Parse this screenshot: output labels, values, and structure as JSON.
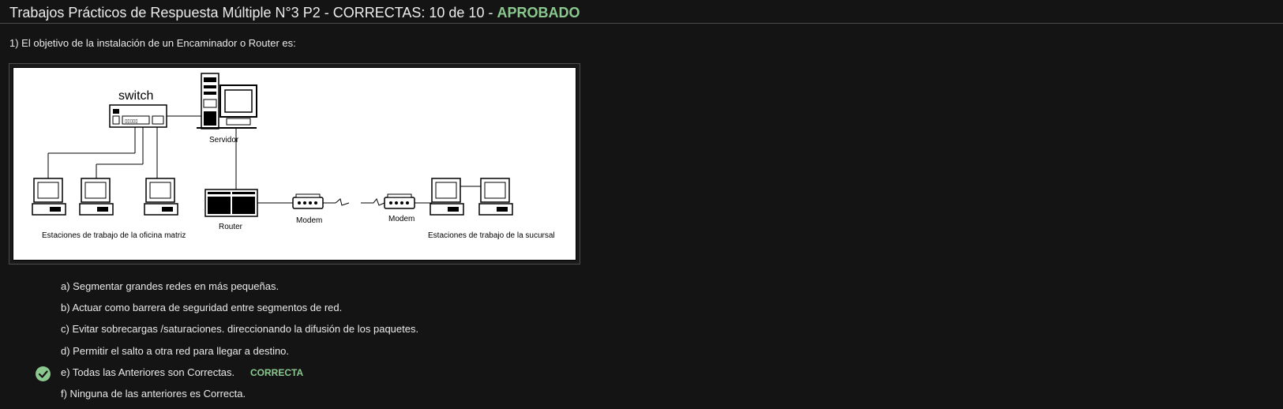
{
  "header": {
    "title": "Trabajos Prácticos de Respuesta Múltiple N°3 P2 - CORRECTAS: 10 de 10 - ",
    "status": "APROBADO"
  },
  "question": {
    "text": "1) El objetivo de la instalación de un Encaminador o Router es:"
  },
  "diagram": {
    "switch": "switch",
    "servidor": "Servidor",
    "router": "Router",
    "modem_left": "Modem",
    "modem_right": "Modem",
    "estaciones_matriz": "Estaciones de trabajo de la oficina matriz",
    "estaciones_sucursal": "Estaciones de trabajo de la sucursal"
  },
  "options": [
    {
      "label": "a) Segmentar grandes redes en más pequeñas."
    },
    {
      "label": "b) Actuar como barrera de seguridad entre segmentos de red."
    },
    {
      "label": "c) Evitar sobrecargas /saturaciones. direccionando la difusión de los paquetes."
    },
    {
      "label": "d) Permitir el salto a otra red para llegar a destino."
    },
    {
      "label": "e) Todas las Anteriores son Correctas.",
      "correct_tag": "CORRECTA",
      "selected": true
    },
    {
      "label": "f) Ninguna de las anteriores es Correcta."
    }
  ],
  "colors": {
    "accent_green": "#8bc88f",
    "background": "#141414"
  },
  "icons": {
    "check": "check-circle-icon"
  }
}
